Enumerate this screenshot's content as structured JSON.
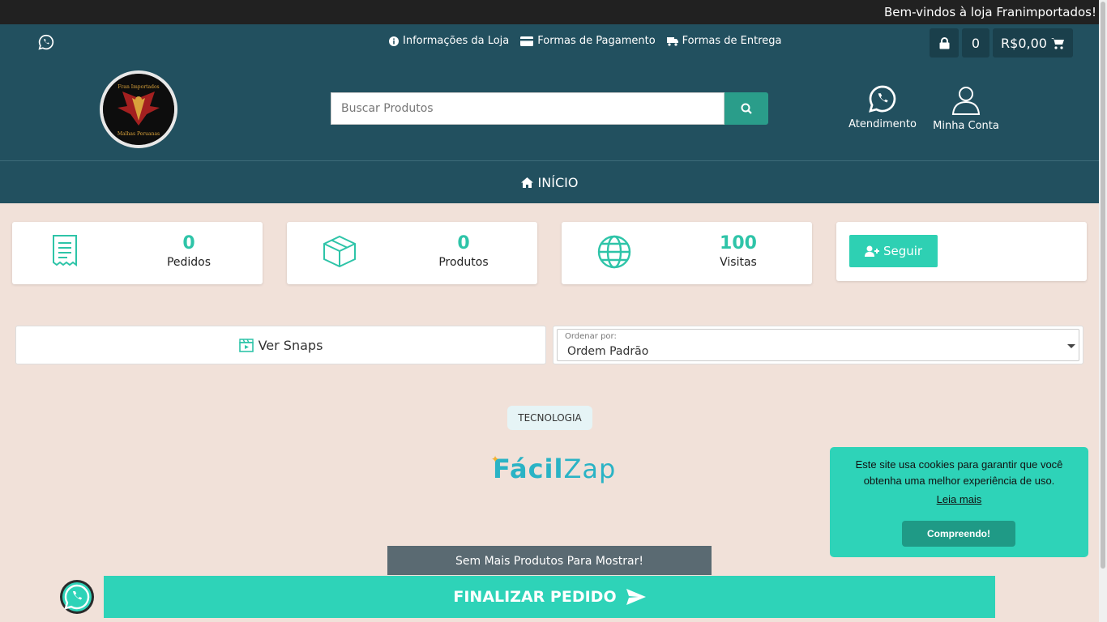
{
  "topbar": {
    "welcome": "Bem-vindos à loja Franimportados!"
  },
  "header": {
    "info_links": [
      {
        "label": "Informações da Loja",
        "icon": "info-icon"
      },
      {
        "label": "Formas de Pagamento",
        "icon": "credit-card-icon"
      },
      {
        "label": "Formas de Entrega",
        "icon": "truck-icon"
      }
    ],
    "cart": {
      "count": "0",
      "total": "R$0,00"
    },
    "logo_text": "Fran Importados",
    "logo_subtext": "Malhas Peruanas",
    "search_placeholder": "Buscar Produtos",
    "atendimento_label": "Atendimento",
    "conta_label": "Minha Conta",
    "nav_home": "INÍCIO"
  },
  "stats": [
    {
      "value": "0",
      "label": "Pedidos",
      "icon": "receipt-icon"
    },
    {
      "value": "0",
      "label": "Produtos",
      "icon": "box-icon"
    },
    {
      "value": "100",
      "label": "Visitas",
      "icon": "globe-icon"
    }
  ],
  "follow_label": "Seguir",
  "snaps_label": "Ver Snaps",
  "order": {
    "small_label": "Ordenar por:",
    "value": "Ordem Padrão"
  },
  "tech_label": "TECNOLOGIA",
  "brand": {
    "part1": "Fácil",
    "part2": "Zap"
  },
  "no_more": "Sem Mais Produtos Para Mostrar!",
  "finalizar_label": "FINALIZAR PEDIDO",
  "cookie": {
    "message": "Este site usa cookies para garantir que você obtenha uma melhor experiência de uso.",
    "more": "Leia mais",
    "ok": "Compreendo!"
  },
  "colors": {
    "header": "#22505f",
    "accent": "#2ed3b8",
    "topbar": "#212121"
  }
}
